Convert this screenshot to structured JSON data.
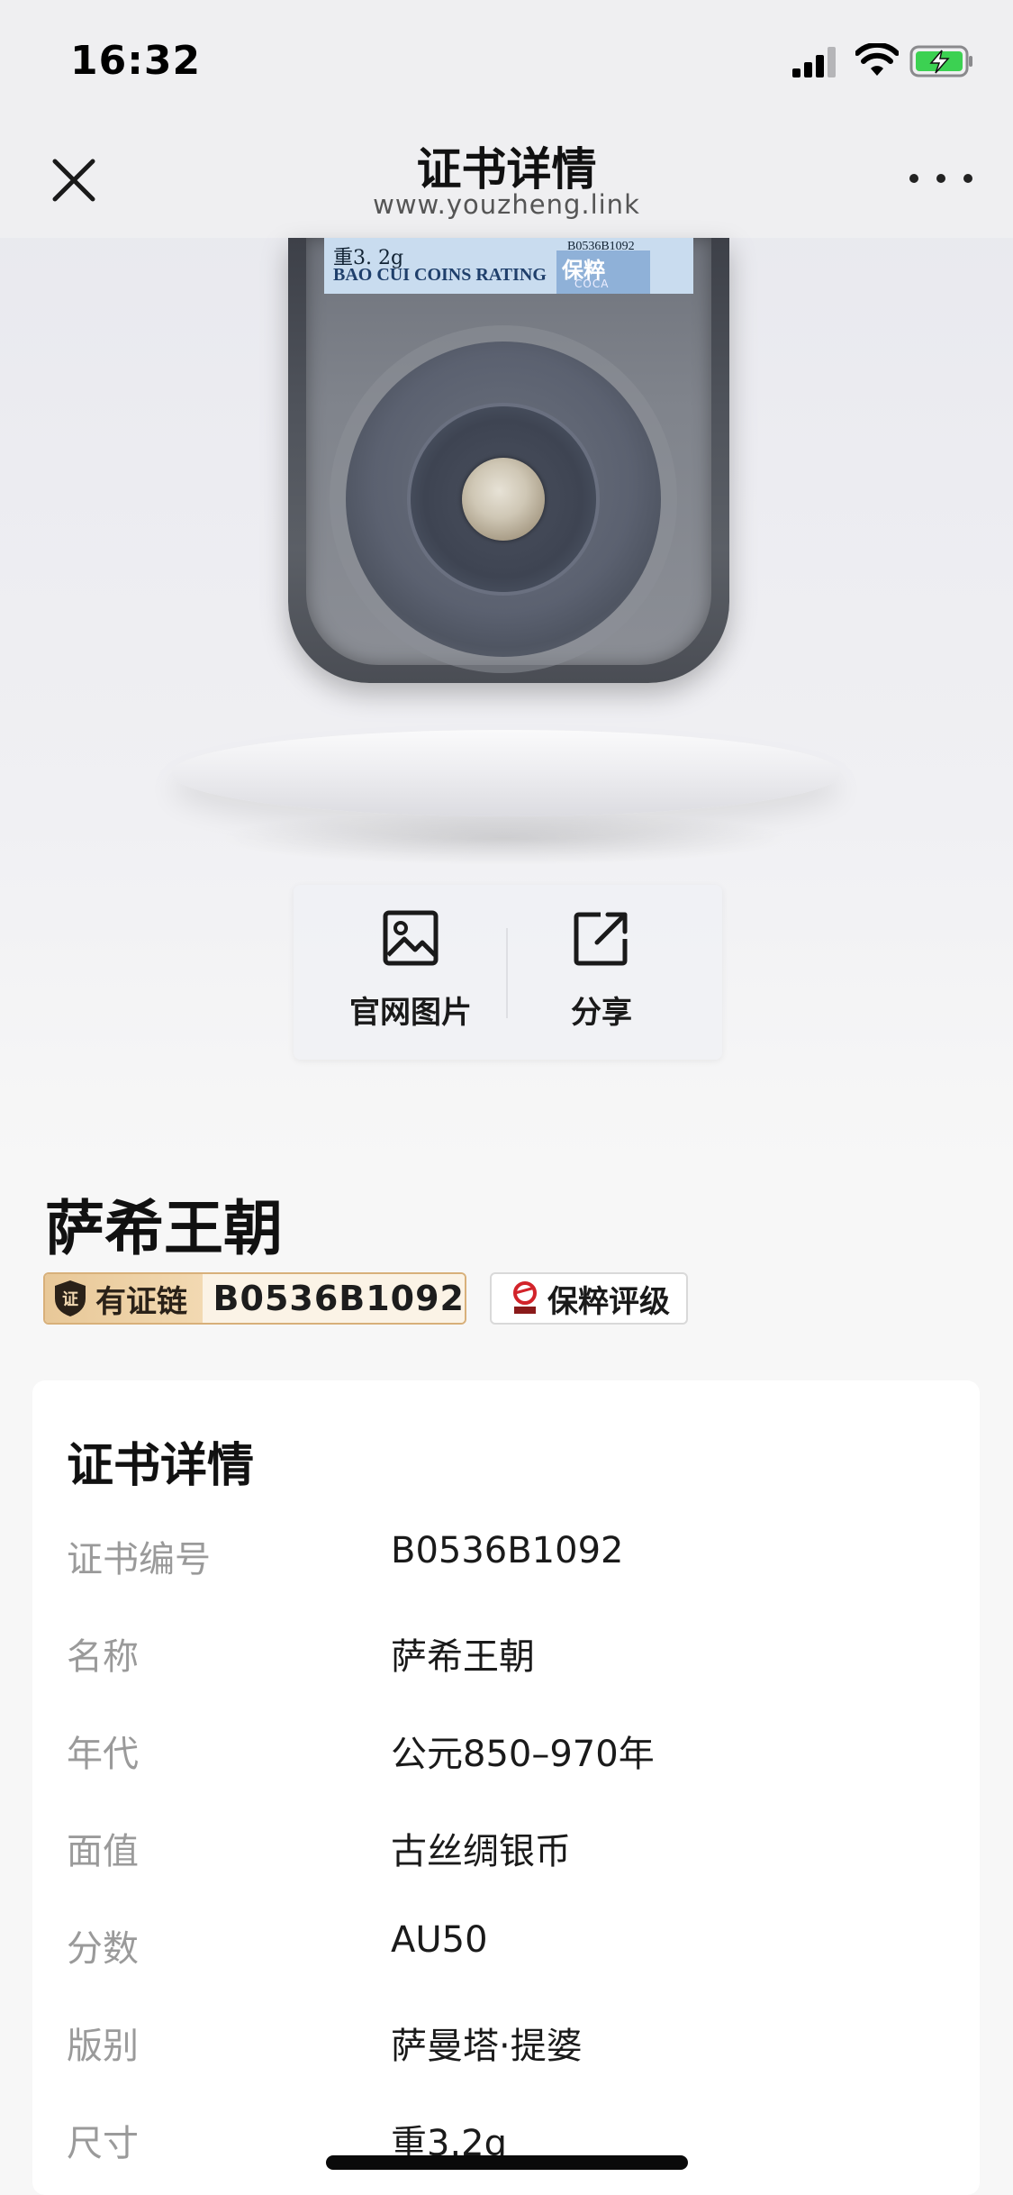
{
  "status_bar": {
    "time": "16:32"
  },
  "nav": {
    "title": "证书详情",
    "subtitle": "www.youzheng.link"
  },
  "slab": {
    "weight": "重3. 2g",
    "rating_text": "BAO CUI COINS RATING",
    "cert_no": "B0536B1092",
    "logo_text": "保粹",
    "logo_sub": "COCA"
  },
  "actions": {
    "official_images": "官网图片",
    "share": "分享"
  },
  "item": {
    "title": "萨希王朝",
    "chain_label": "有证链",
    "chain_icon_text": "证",
    "cert_number": "B0536B1092",
    "org_name": "保粹评级"
  },
  "details": {
    "title": "证书详情",
    "rows": [
      {
        "label": "证书编号",
        "value": "B0536B1092"
      },
      {
        "label": "名称",
        "value": "萨希王朝"
      },
      {
        "label": "年代",
        "value": "公元850–970年"
      },
      {
        "label": "面值",
        "value": "古丝绸银币"
      },
      {
        "label": "分数",
        "value": "AU50"
      },
      {
        "label": "版别",
        "value": "萨曼塔·提婆"
      },
      {
        "label": "尺寸",
        "value": "重3.2g"
      }
    ]
  },
  "icons": {
    "close": "close-icon",
    "more": "more-icon",
    "image": "image-icon",
    "share": "share-icon",
    "shield": "shield-icon",
    "org_logo": "org-logo-icon"
  },
  "colors": {
    "chain_gold": "#e8c898",
    "chain_border": "#d8b07a",
    "text_muted": "#9a9a9a"
  }
}
